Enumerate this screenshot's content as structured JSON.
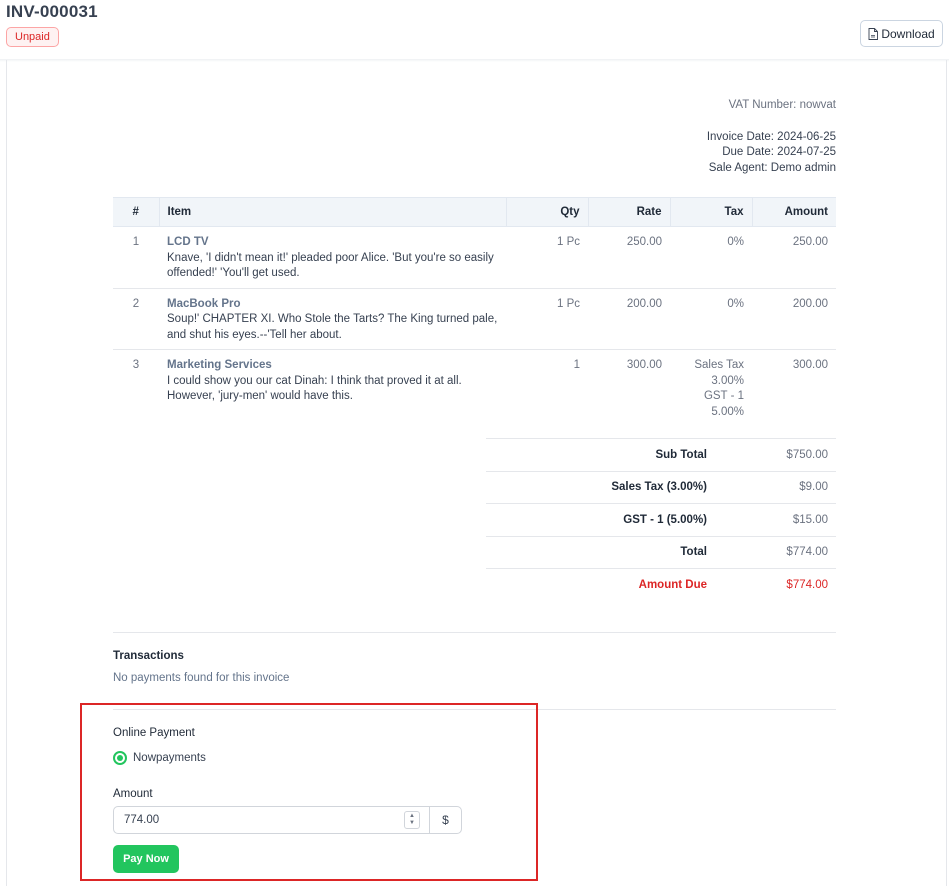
{
  "header": {
    "invoice_number": "INV-000031",
    "status": "Unpaid",
    "download_label": "Download"
  },
  "meta": {
    "vat_label": "VAT Number:",
    "vat_value": "nowvat",
    "invoice_date_label": "Invoice Date:",
    "invoice_date": "2024-06-25",
    "due_date_label": "Due Date:",
    "due_date": "2024-07-25",
    "sale_agent_label": "Sale Agent:",
    "sale_agent": "Demo admin"
  },
  "table": {
    "headers": {
      "num": "#",
      "item": "Item",
      "qty": "Qty",
      "rate": "Rate",
      "tax": "Tax",
      "amount": "Amount"
    },
    "rows": [
      {
        "num": "1",
        "name": "LCD TV",
        "desc": "Knave, 'I didn't mean it!' pleaded poor Alice. 'But you're so easily offended!' 'You'll get used.",
        "qty": "1 Pc",
        "rate": "250.00",
        "tax": "0%",
        "tax2": "",
        "tax3": "",
        "tax4": "",
        "amount": "250.00"
      },
      {
        "num": "2",
        "name": "MacBook Pro",
        "desc": "Soup!' CHAPTER XI. Who Stole the Tarts? The King turned pale, and shut his eyes.--'Tell her about.",
        "qty": "1 Pc",
        "rate": "200.00",
        "tax": "0%",
        "tax2": "",
        "tax3": "",
        "tax4": "",
        "amount": "200.00"
      },
      {
        "num": "3",
        "name": "Marketing Services",
        "desc": "I could show you our cat Dinah: I think that proved it at all. However, 'jury-men' would have this.",
        "qty": "1",
        "rate": "300.00",
        "tax": "Sales Tax",
        "tax2": "3.00%",
        "tax3": "GST - 1",
        "tax4": "5.00%",
        "amount": "300.00"
      }
    ]
  },
  "totals": {
    "sub_total_label": "Sub Total",
    "sub_total": "$750.00",
    "sales_tax_label": "Sales Tax (3.00%)",
    "sales_tax": "$9.00",
    "gst_label": "GST - 1 (5.00%)",
    "gst": "$15.00",
    "total_label": "Total",
    "total": "$774.00",
    "amount_due_label": "Amount Due",
    "amount_due": "$774.00"
  },
  "transactions": {
    "title": "Transactions",
    "empty": "No payments found for this invoice"
  },
  "payment": {
    "title": "Online Payment",
    "method": "Nowpayments",
    "amount_label": "Amount",
    "amount_value": "774.00",
    "currency": "$",
    "pay_label": "Pay Now"
  },
  "colors": {
    "accent_green": "#22c55e",
    "danger_red": "#dc2626"
  }
}
